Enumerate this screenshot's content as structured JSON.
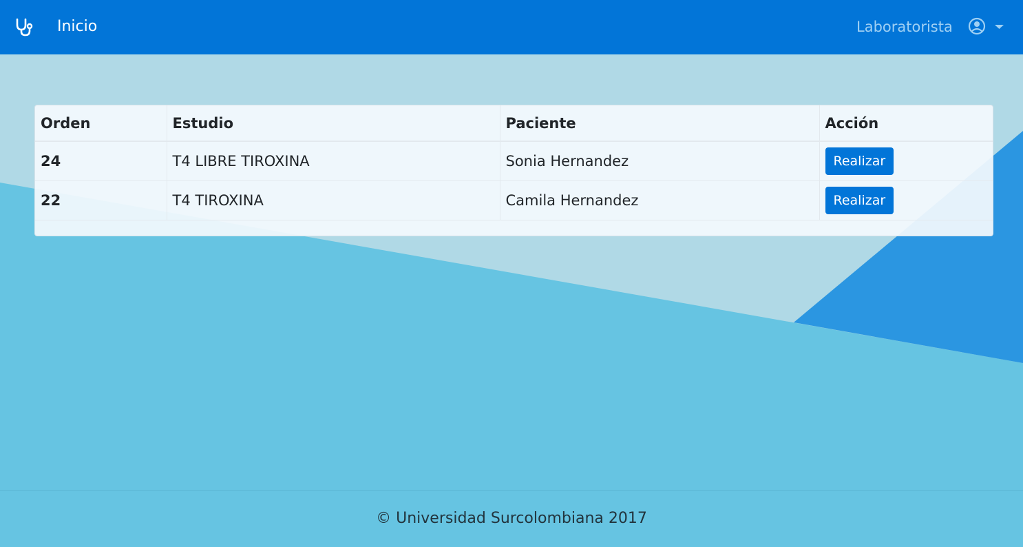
{
  "navbar": {
    "brand_icon": "stethoscope-icon",
    "home_label": "Inicio",
    "user_label": "Laboratorista",
    "user_icon": "user-circle-icon",
    "dropdown_icon": "caret-down-icon",
    "background_color": "#0275d8"
  },
  "table": {
    "headers": [
      "Orden",
      "Estudio",
      "Paciente",
      "Acción"
    ],
    "rows": [
      {
        "orden": "24",
        "estudio": "T4 LIBRE TIROXINA",
        "paciente": "Sonia Hernandez",
        "accion": "Realizar"
      },
      {
        "orden": "22",
        "estudio": "T4 TIROXINA",
        "paciente": "Camila Hernandez",
        "accion": "Realizar"
      }
    ]
  },
  "footer": {
    "text": "© Universidad Surcolombiana 2017"
  },
  "colors": {
    "accent": "#0275d8",
    "background_light": "#b0d9e6",
    "background_mid": "#66c4e2",
    "background_dark": "#2b96e1"
  }
}
